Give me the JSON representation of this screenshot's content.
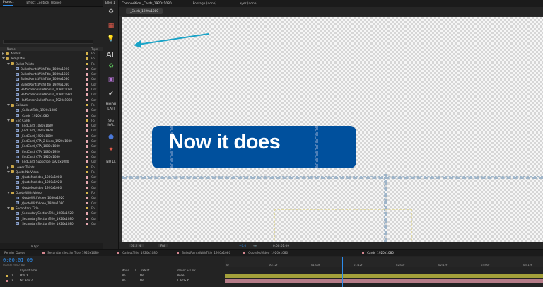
{
  "project_panel": {
    "tabs": [
      "Project",
      "Effect Controls (none)"
    ],
    "headers": {
      "name": "Name",
      "type": "Type"
    },
    "rows": [
      {
        "depth": 0,
        "kind": "folder",
        "open": false,
        "label": "Assets",
        "type": "Fol",
        "swatch": "#d6b44b"
      },
      {
        "depth": 0,
        "kind": "folder",
        "open": true,
        "label": "Templates",
        "type": "Fol",
        "swatch": "#d6b44b"
      },
      {
        "depth": 1,
        "kind": "folder",
        "open": true,
        "label": "Bullet Points",
        "type": "Fol",
        "swatch": "#d6b44b"
      },
      {
        "depth": 2,
        "kind": "comp",
        "label": "BulletPointsWithTitle_1080x1920",
        "type": "Cor",
        "swatch": "#e6a8b0"
      },
      {
        "depth": 2,
        "kind": "comp",
        "label": "BulletPointsWithTitle_1080x1350",
        "type": "Cor",
        "swatch": "#e6a8b0"
      },
      {
        "depth": 2,
        "kind": "comp",
        "label": "BulletPointsWithTitle_1080x1080",
        "type": "Cor",
        "swatch": "#e6a8b0"
      },
      {
        "depth": 2,
        "kind": "comp",
        "label": "BulletPointsWithTitle_1920x1080",
        "type": "Cor",
        "swatch": "#e6a8b0"
      },
      {
        "depth": 2,
        "kind": "comp",
        "label": "HalfScreenBulletPoints_1080x1080",
        "type": "Cor",
        "swatch": "#e6a8b0"
      },
      {
        "depth": 2,
        "kind": "comp",
        "label": "HalfScreenBulletPoints_1080x1920",
        "type": "Cor",
        "swatch": "#e6a8b0"
      },
      {
        "depth": 2,
        "kind": "comp",
        "label": "HalfScreenBulletPoints_1920x1080",
        "type": "Cor",
        "swatch": "#e6a8b0"
      },
      {
        "depth": 1,
        "kind": "folder",
        "open": true,
        "label": "Callouts",
        "type": "Fol",
        "swatch": "#d6b44b"
      },
      {
        "depth": 2,
        "kind": "comp",
        "label": "_CalloutTitle_1920x1080",
        "type": "Cor",
        "swatch": "#e6a8b0"
      },
      {
        "depth": 2,
        "kind": "comp",
        "label": "_Cards_1920x1080",
        "type": "Cor",
        "swatch": "#e6a8b0"
      },
      {
        "depth": 1,
        "kind": "folder",
        "open": true,
        "label": "End Cards",
        "type": "Fol",
        "swatch": "#d6b44b"
      },
      {
        "depth": 2,
        "kind": "comp",
        "label": "_EndCard_1080x1080",
        "type": "Cor",
        "swatch": "#e6a8b0"
      },
      {
        "depth": 2,
        "kind": "comp",
        "label": "_EndCard_1080x1920",
        "type": "Cor",
        "swatch": "#e6a8b0"
      },
      {
        "depth": 2,
        "kind": "comp",
        "label": "_EndCard_1920x1080",
        "type": "Cor",
        "swatch": "#e6a8b0"
      },
      {
        "depth": 2,
        "kind": "comp",
        "label": "_EndCard_CTA_2 Lines_1920x1080",
        "type": "Cor",
        "swatch": "#e6a8b0"
      },
      {
        "depth": 2,
        "kind": "comp",
        "label": "_EndCard_CTA_1080x1080",
        "type": "Cor",
        "swatch": "#e6a8b0"
      },
      {
        "depth": 2,
        "kind": "comp",
        "label": "_EndCard_CTA_1080x1920",
        "type": "Cor",
        "swatch": "#e6a8b0"
      },
      {
        "depth": 2,
        "kind": "comp",
        "label": "_EndCard_CTA_1920x1080",
        "type": "Cor",
        "swatch": "#e6a8b0"
      },
      {
        "depth": 2,
        "kind": "comp",
        "label": "_EndCard_Subscribe_1920x1080",
        "type": "Cor",
        "swatch": "#e6a8b0"
      },
      {
        "depth": 1,
        "kind": "folder",
        "open": false,
        "label": "Lower Thirds",
        "type": "Fol",
        "swatch": "#d6b44b"
      },
      {
        "depth": 1,
        "kind": "folder",
        "open": true,
        "label": "Quote No Video",
        "type": "Fol",
        "swatch": "#d6b44b"
      },
      {
        "depth": 2,
        "kind": "comp",
        "label": "_QuoteNoVideo_1080x1080",
        "type": "Cor",
        "swatch": "#e6a8b0"
      },
      {
        "depth": 2,
        "kind": "comp",
        "label": "_QuoteNoVideo_1080x1920",
        "type": "Cor",
        "swatch": "#e6a8b0"
      },
      {
        "depth": 2,
        "kind": "comp",
        "label": "_QuoteNoVideo_1920x1080",
        "type": "Cor",
        "swatch": "#e6a8b0"
      },
      {
        "depth": 1,
        "kind": "folder",
        "open": true,
        "label": "Quote With Video",
        "type": "Fol",
        "swatch": "#d6b44b"
      },
      {
        "depth": 2,
        "kind": "comp",
        "label": "_QuoteWithVideo_1080x1920",
        "type": "Cor",
        "swatch": "#e6a8b0"
      },
      {
        "depth": 2,
        "kind": "comp",
        "label": "_QuoteWithVideo_1920x1080",
        "type": "Cor",
        "swatch": "#e6a8b0"
      },
      {
        "depth": 1,
        "kind": "folder",
        "open": true,
        "label": "Secondary Title",
        "type": "Fol",
        "swatch": "#d6b44b"
      },
      {
        "depth": 2,
        "kind": "comp",
        "label": "_SecondarySectionTitle_1080x1920",
        "type": "Cor",
        "swatch": "#e6a8b0"
      },
      {
        "depth": 2,
        "kind": "comp",
        "label": "_SecondarySectionTitle_1920x1080",
        "type": "Cor",
        "swatch": "#e6a8b0"
      },
      {
        "depth": 2,
        "kind": "comp",
        "label": "_SecondarySectionTitle_1920x1080",
        "type": "Cor",
        "swatch": "#e6a8b0"
      }
    ],
    "footer_depth": "8 bpc"
  },
  "toolbar": {
    "title": "Eller 1",
    "items": [
      {
        "name": "gear-icon",
        "glyph": "⚙"
      },
      {
        "name": "grid-icon",
        "glyph": "▦"
      },
      {
        "name": "lightbulb-icon",
        "glyph": "💡"
      },
      {
        "name": "align-icon",
        "glyph": "AL"
      },
      {
        "name": "recycle-icon",
        "glyph": "♻"
      },
      {
        "name": "image-icon",
        "glyph": "▣"
      },
      {
        "name": "check-icon",
        "glyph": "✔"
      },
      {
        "name": "modulate-icon",
        "glyph": "MODU LATI"
      },
      {
        "name": "signal-icon",
        "glyph": "SIG NAL"
      },
      {
        "name": "circle-icon",
        "glyph": "●"
      },
      {
        "name": "target-icon",
        "glyph": "✦"
      },
      {
        "name": "null-icon",
        "glyph": "NU LL"
      }
    ]
  },
  "viewer": {
    "tabs": [
      "Composition _Cards_1920x1080",
      "Footage (none)",
      "Layer (none)"
    ],
    "subtab": "_Cards_1920x1080",
    "pill_text": "Now it does",
    "pill_color": "#00509d",
    "footer": {
      "zoom": "50.2 %",
      "resolution": "Full",
      "exposure": "+0.0",
      "time": "0:00:01:09"
    }
  },
  "timeline": {
    "tabs": [
      "Render Queue",
      "_SecondarySectionTitle_1920x1080",
      "_CalloutTitle_1920x1080",
      "_BulletPointsWithTitle_1920x1080",
      "_QuoteNoVideo_1920x1080",
      "_Cards_1920x1080"
    ],
    "timecode": "0:00:01:09",
    "fps": "00033 (25.00 fps)",
    "headers": [
      "Layer Name",
      "Mode",
      "T",
      "TrkMat",
      "Parent & Link"
    ],
    "layers": [
      {
        "num": "1",
        "name": "POS Y",
        "mode": "No",
        "trkmat": "No",
        "parent": "None",
        "color": "#d6b44b",
        "bar": "#a3a03a"
      },
      {
        "num": "2",
        "name": "txt Box 2",
        "mode": "No",
        "trkmat": "No",
        "parent": "1. POS Y",
        "color": "#d4868f",
        "bar": "#b57c88"
      }
    ],
    "ruler": [
      "0f",
      "00:12f",
      "01:00f",
      "01:12f",
      "02:00f",
      "02:12f",
      "03:00f",
      "03:12f"
    ]
  }
}
